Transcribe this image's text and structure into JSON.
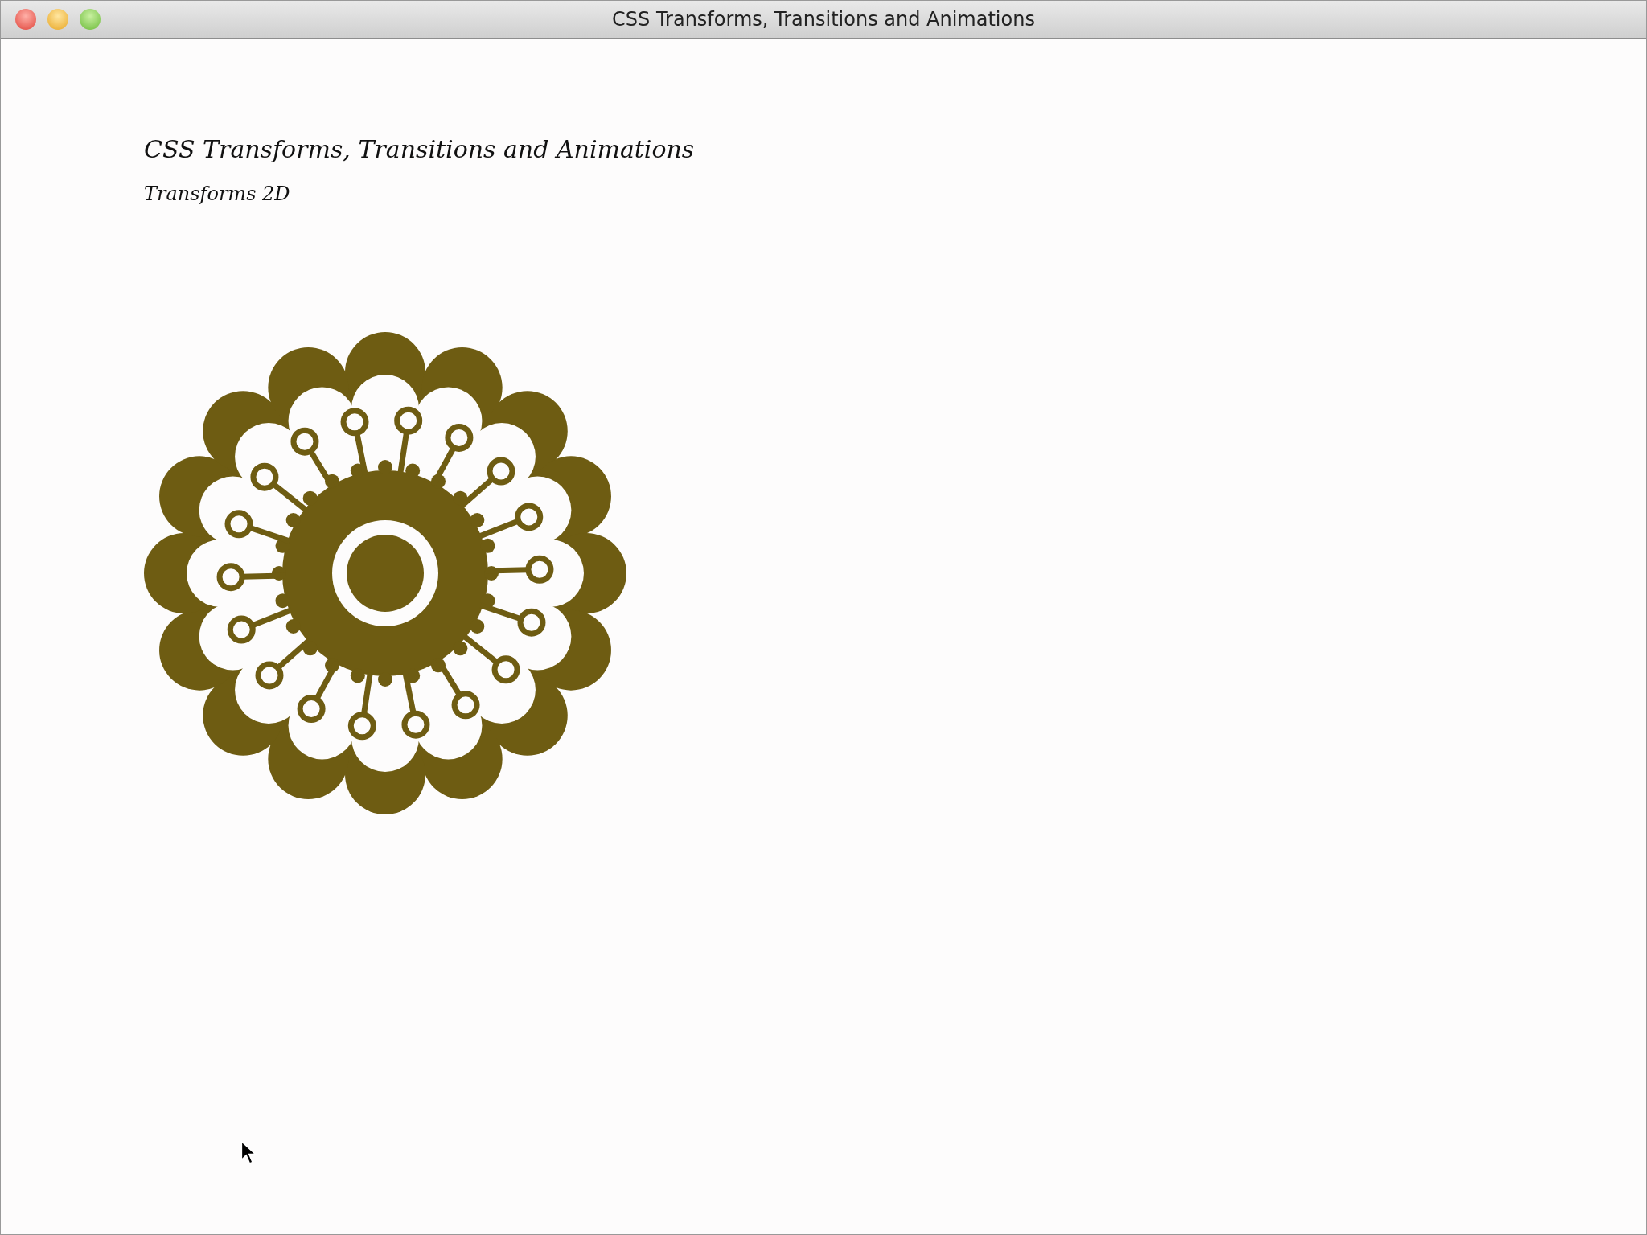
{
  "window": {
    "title": "CSS Transforms, Transitions and Animations"
  },
  "page": {
    "heading": "CSS Transforms, Transitions and Animations",
    "subheading": "Transforms 2D"
  }
}
